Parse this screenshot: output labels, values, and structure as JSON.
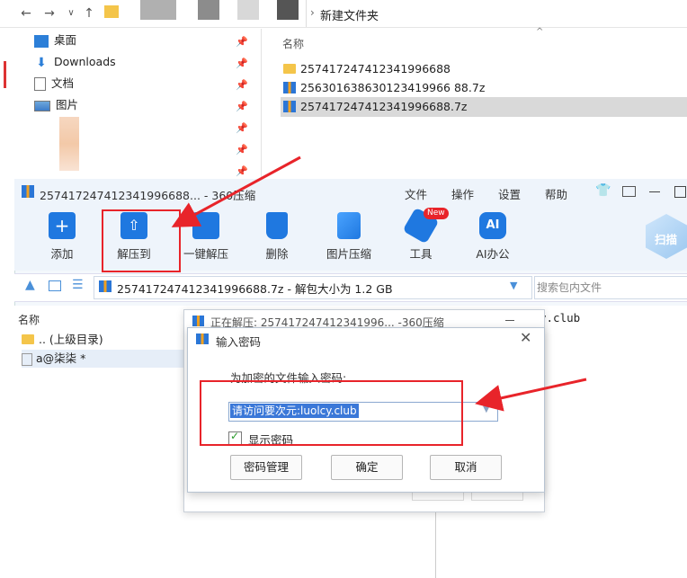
{
  "explorer": {
    "address_path": "新建文件夹",
    "sidebar": [
      {
        "label": "桌面",
        "icon": "desktop-icon"
      },
      {
        "label": "Downloads",
        "icon": "download-icon"
      },
      {
        "label": "文档",
        "icon": "document-icon"
      },
      {
        "label": "图片",
        "icon": "picture-icon"
      }
    ],
    "column_name": "名称",
    "files": [
      {
        "name": "257417247412341996688",
        "type": "folder",
        "selected": false
      },
      {
        "name": "256301638630123419966 88.7z",
        "type": "archive",
        "selected": false
      },
      {
        "name": "257417247412341996688.7z",
        "type": "archive",
        "selected": true
      }
    ]
  },
  "app": {
    "window_title": "257417247412341996688... - 360压缩",
    "menu": [
      "文件",
      "操作",
      "设置",
      "帮助"
    ],
    "toolbar": [
      {
        "label": "添加",
        "icon": "add-icon"
      },
      {
        "label": "解压到",
        "icon": "extract-to-icon"
      },
      {
        "label": "一键解压",
        "icon": "one-click-extract-icon"
      },
      {
        "label": "删除",
        "icon": "delete-icon"
      },
      {
        "label": "图片压缩",
        "icon": "image-compress-icon"
      },
      {
        "label": "工具",
        "icon": "tools-icon",
        "badge": "New"
      },
      {
        "label": "AI办公",
        "icon": "ai-office-icon",
        "glyph": "AI"
      }
    ],
    "scan_label": "扫描",
    "path_text": "257417247412341996688.7z - 解包大小为 1.2 GB",
    "search_placeholder": "搜索包内文件",
    "list_header": "名称",
    "list_rows": [
      ".. (上级目录)",
      "a@柒柒 *"
    ],
    "right_text": "y.club"
  },
  "progress_dialog": {
    "title": "正在解压: 257417247412341996... -360压缩"
  },
  "password_dialog": {
    "title": "输入密码",
    "prompt": "为加密的文件输入密码:",
    "password_value": "请访问要次元:luolcy.club",
    "show_password_label": "显示密码",
    "buttons": {
      "manage": "密码管理",
      "ok": "确定",
      "cancel": "取消"
    }
  },
  "colors": {
    "accent": "#1f78e0",
    "annotation": "#e8242a",
    "selection": "#3b78d8"
  }
}
